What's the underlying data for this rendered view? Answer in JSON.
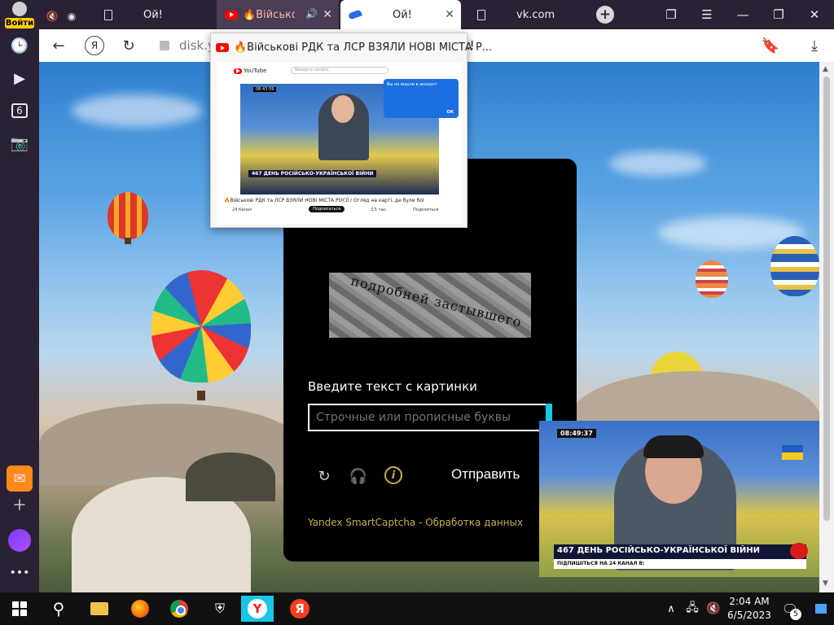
{
  "sidebar": {
    "login_label": "Войти",
    "tab_count_badge": "6"
  },
  "tabs": [
    {
      "title": "Ой!"
    },
    {
      "title": "🔥Військові"
    },
    {
      "title": "Ой!"
    },
    {
      "title": "vk.com"
    }
  ],
  "navbar": {
    "address": "disk.y",
    "page_title_rest": "k!"
  },
  "preview": {
    "title": "🔥Військові РДК та ЛСР ВЗЯЛИ НОВІ МІСТА Р...",
    "yt_logo": "YouTube",
    "search_placeholder": "Введите запрос",
    "video_time": "08:43:59",
    "video_ticker": "467 ДЕНЬ РОСІЙСЬКО-УКРАЇНСЬКОЇ ВІЙНИ",
    "video_caption": "🔥Військові РДК та ЛСР ВЗЯЛИ НОВІ МІСТА РОСІЇ / Огляд на карті, де були бої",
    "channel": "24 Канал",
    "subscribe": "Подписаться",
    "likes": "3,5 тыс.",
    "share": "Поделиться",
    "popup_title": "Вы не вошли в аккаунт",
    "popup_ok": "ОК"
  },
  "captcha": {
    "image_word": "подробней застывшего",
    "label": "Введите текст с картинки",
    "input_placeholder": "Строчные или прописные буквы",
    "submit": "Отправить",
    "footer": "Yandex SmartCaptcha - Обработка данных"
  },
  "pip": {
    "time": "08:49:37",
    "ticker": "467 ДЕНЬ РОСІЙСЬКО-УКРАЇНСЬКОЇ ВІЙНИ",
    "sub": "ПІДПИШІТЬСЯ НА 24 КАНАЛ В:"
  },
  "taskbar": {
    "time": "2:04 AM",
    "date": "6/5/2023",
    "notifications": "5"
  }
}
